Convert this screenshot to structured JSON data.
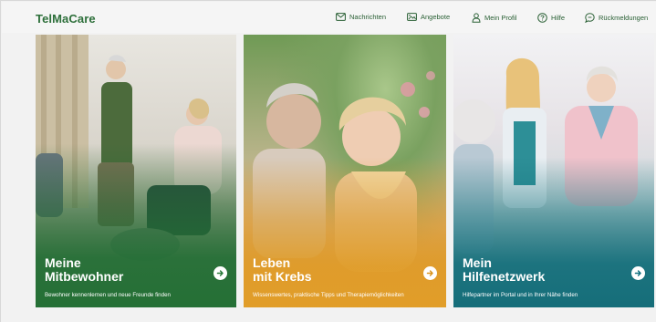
{
  "app": {
    "logo": "TelMaCare"
  },
  "nav": {
    "items": [
      {
        "id": "nachrichten",
        "label": "Nachrichten",
        "icon": "envelope-icon"
      },
      {
        "id": "angebote",
        "label": "Angebote",
        "icon": "image-gallery-icon"
      },
      {
        "id": "profil",
        "label": "Mein Profil",
        "icon": "user-icon"
      },
      {
        "id": "hilfe",
        "label": "Hilfe",
        "icon": "help-circle-icon"
      },
      {
        "id": "rueckmeldungen",
        "label": "Rückmeldungen",
        "icon": "chat-bubble-icon"
      }
    ]
  },
  "cards": [
    {
      "title": "Meine\nMitbewohner",
      "subtitle": "Bewohner kennenlernen und neue Freunde finden",
      "icon": "arrow-right-icon",
      "color": "#2a7a3a"
    },
    {
      "title": "Leben\nmit Krebs",
      "subtitle": "Wissenswertes, praktische Tipps und Therapiemöglichkeiten",
      "icon": "arrow-right-icon",
      "color": "#e09c28"
    },
    {
      "title": "Mein\nHilfenetzwerk",
      "subtitle": "Hilfepartner im Portal und in Ihrer Nähe finden",
      "icon": "arrow-right-icon",
      "color": "#127080"
    }
  ]
}
